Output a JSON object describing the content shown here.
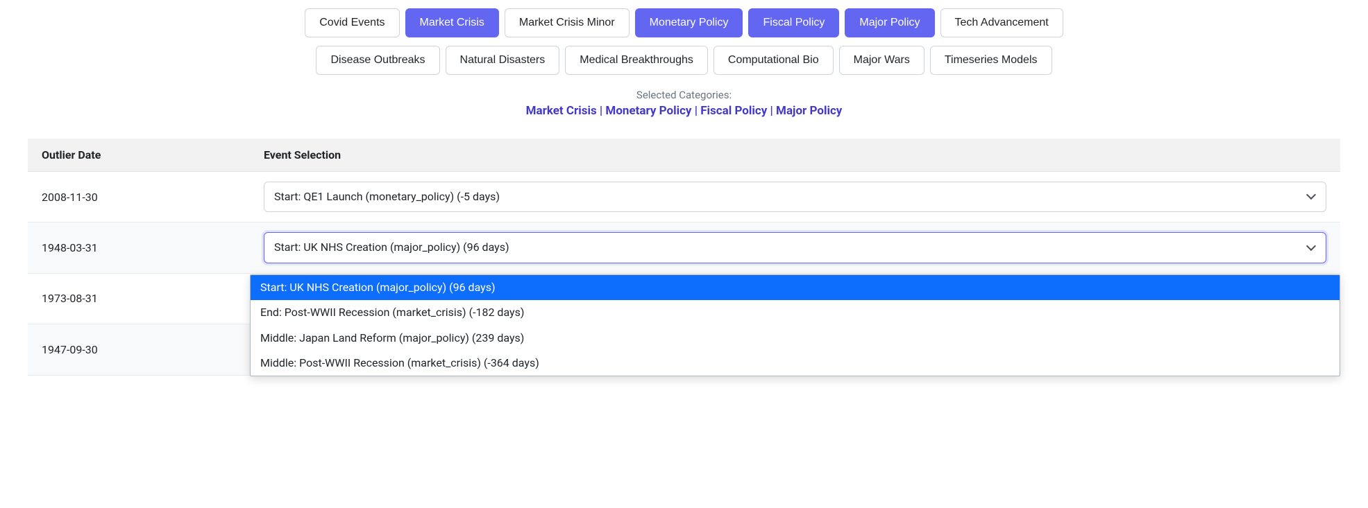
{
  "filters": {
    "row1": [
      {
        "label": "Covid Events",
        "active": false
      },
      {
        "label": "Market Crisis",
        "active": true
      },
      {
        "label": "Market Crisis Minor",
        "active": false
      },
      {
        "label": "Monetary Policy",
        "active": true
      },
      {
        "label": "Fiscal Policy",
        "active": true
      },
      {
        "label": "Major Policy",
        "active": true
      },
      {
        "label": "Tech Advancement",
        "active": false
      }
    ],
    "row2": [
      {
        "label": "Disease Outbreaks",
        "active": false
      },
      {
        "label": "Natural Disasters",
        "active": false
      },
      {
        "label": "Medical Breakthroughs",
        "active": false
      },
      {
        "label": "Computational Bio",
        "active": false
      },
      {
        "label": "Major Wars",
        "active": false
      },
      {
        "label": "Timeseries Models",
        "active": false
      }
    ]
  },
  "summary": {
    "label": "Selected Categories:",
    "values": "Market Crisis | Monetary Policy | Fiscal Policy | Major Policy"
  },
  "table": {
    "headers": {
      "outlier_date": "Outlier Date",
      "event_selection": "Event Selection"
    },
    "rows": [
      {
        "date": "2008-11-30",
        "selected": "Start: QE1 Launch (monetary_policy) (-5 days)",
        "open": false
      },
      {
        "date": "1948-03-31",
        "selected": "Start: UK NHS Creation (major_policy) (96 days)",
        "open": true,
        "options": [
          {
            "label": "Start: UK NHS Creation (major_policy) (96 days)",
            "highlighted": true
          },
          {
            "label": "End: Post-WWII Recession (market_crisis) (-182 days)",
            "highlighted": false
          },
          {
            "label": "Middle: Japan Land Reform (major_policy) (239 days)",
            "highlighted": false
          },
          {
            "label": "Middle: Post-WWII Recession (market_crisis) (-364 days)",
            "highlighted": false
          }
        ]
      },
      {
        "date": "1973-08-31",
        "selected": "",
        "open": false
      },
      {
        "date": "1947-09-30",
        "selected": "",
        "open": false
      }
    ]
  }
}
